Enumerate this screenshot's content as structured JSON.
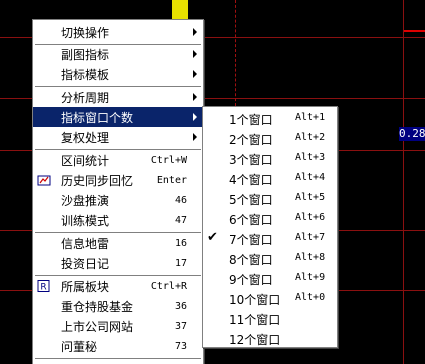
{
  "background": {
    "price_label": "0.28",
    "colors": {
      "grid": "#8a1010",
      "bar": "#e8e000",
      "label_bg": "#000080"
    }
  },
  "menu": {
    "items": [
      {
        "label": "切换操作",
        "submenu": true
      },
      {
        "label": "副图指标",
        "submenu": true
      },
      {
        "label": "指标模板",
        "submenu": true
      },
      {
        "label": "分析周期",
        "submenu": true
      },
      {
        "label": "指标窗口个数",
        "submenu": true,
        "selected": true
      },
      {
        "label": "复权处理",
        "submenu": true
      },
      {
        "label": "区间统计",
        "shortcut": "Ctrl+W"
      },
      {
        "label": "历史同步回忆",
        "shortcut": "Enter",
        "icon": "history-icon"
      },
      {
        "label": "沙盘推演",
        "shortcut": "46"
      },
      {
        "label": "训练模式",
        "shortcut": "47"
      },
      {
        "label": "信息地雷",
        "shortcut": "16"
      },
      {
        "label": "投资日记",
        "shortcut": "17"
      },
      {
        "label": "所属板块",
        "shortcut": "Ctrl+R",
        "icon": "r-icon"
      },
      {
        "label": "重仓持股基金",
        "shortcut": "36"
      },
      {
        "label": "上市公司网站",
        "shortcut": "37"
      },
      {
        "label": "问董秘",
        "shortcut": "73"
      }
    ]
  },
  "submenu": {
    "items": [
      {
        "label": "1个窗口",
        "shortcut": "Alt+1"
      },
      {
        "label": "2个窗口",
        "shortcut": "Alt+2"
      },
      {
        "label": "3个窗口",
        "shortcut": "Alt+3"
      },
      {
        "label": "4个窗口",
        "shortcut": "Alt+4"
      },
      {
        "label": "5个窗口",
        "shortcut": "Alt+5"
      },
      {
        "label": "6个窗口",
        "shortcut": "Alt+6"
      },
      {
        "label": "7个窗口",
        "shortcut": "Alt+7",
        "checked": true
      },
      {
        "label": "8个窗口",
        "shortcut": "Alt+8"
      },
      {
        "label": "9个窗口",
        "shortcut": "Alt+9"
      },
      {
        "label": "10个窗口",
        "shortcut": "Alt+0"
      },
      {
        "label": "11个窗口",
        "shortcut": ""
      },
      {
        "label": "12个窗口",
        "shortcut": ""
      }
    ]
  }
}
